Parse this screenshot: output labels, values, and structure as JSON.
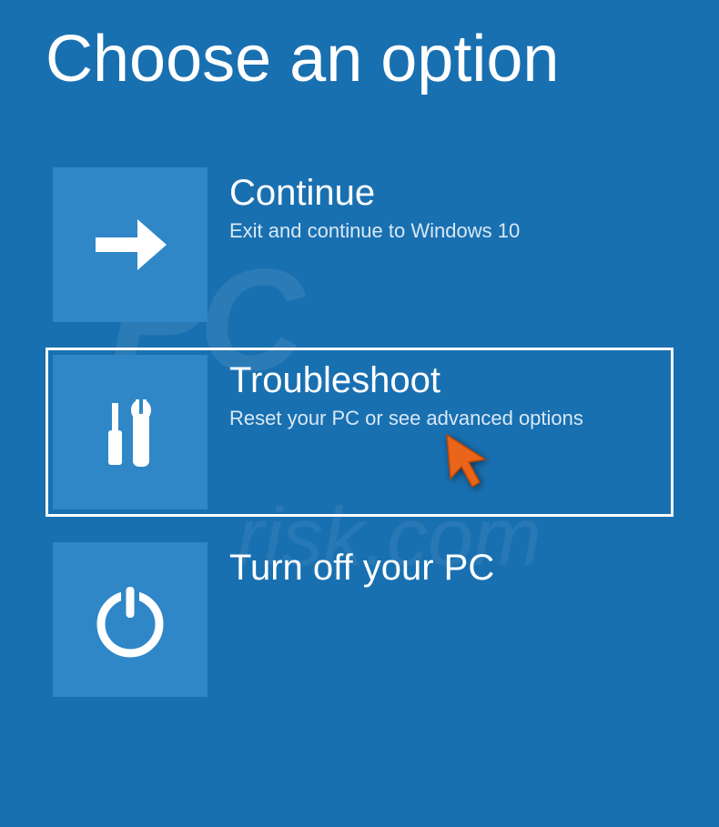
{
  "title": "Choose an option",
  "options": [
    {
      "title": "Continue",
      "subtitle": "Exit and continue to Windows 10",
      "icon": "arrow-right"
    },
    {
      "title": "Troubleshoot",
      "subtitle": "Reset your PC or see advanced options",
      "icon": "tools",
      "selected": true,
      "pointer": true
    },
    {
      "title": "Turn off your PC",
      "subtitle": "",
      "icon": "power"
    }
  ],
  "watermark": {
    "main": "PC",
    "sub": "risk.com"
  }
}
